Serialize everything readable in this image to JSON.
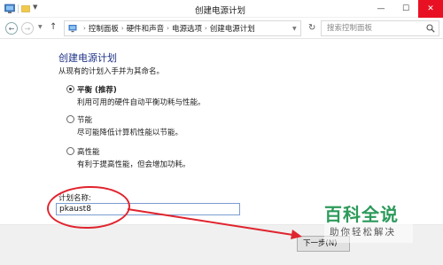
{
  "window": {
    "title": "创建电源计划",
    "buttons": {
      "minimize": "—",
      "maximize": "☐",
      "close": "✕"
    }
  },
  "nav": {
    "breadcrumb": [
      "控制面板",
      "硬件和声音",
      "电源选项",
      "创建电源计划"
    ],
    "search_placeholder": "搜索控制面板"
  },
  "page": {
    "title": "创建电源计划",
    "subtitle": "从现有的计划入手并为其命名。",
    "options": [
      {
        "label": "平衡 (推荐)",
        "description": "利用可用的硬件自动平衡功耗与性能。",
        "checked": true
      },
      {
        "label": "节能",
        "description": "尽可能降低计算机性能以节能。",
        "checked": false
      },
      {
        "label": "高性能",
        "description": "有利于提高性能，但会增加功耗。",
        "checked": false
      }
    ],
    "plan_name_label": "计划名称:",
    "plan_name_value": "pkaust8",
    "next_button": "下一步(N)"
  },
  "watermark": {
    "title": "百科全说",
    "subtitle": "助你轻松解决"
  },
  "colors": {
    "title_blue": "#1e3287",
    "annotation_red": "#e0242e",
    "close_red": "#e81123",
    "watermark_green": "#2c9a5a"
  },
  "icons": [
    "control-panel-icon",
    "back-arrow-icon",
    "forward-arrow-icon",
    "up-arrow-icon",
    "refresh-icon",
    "search-icon"
  ]
}
